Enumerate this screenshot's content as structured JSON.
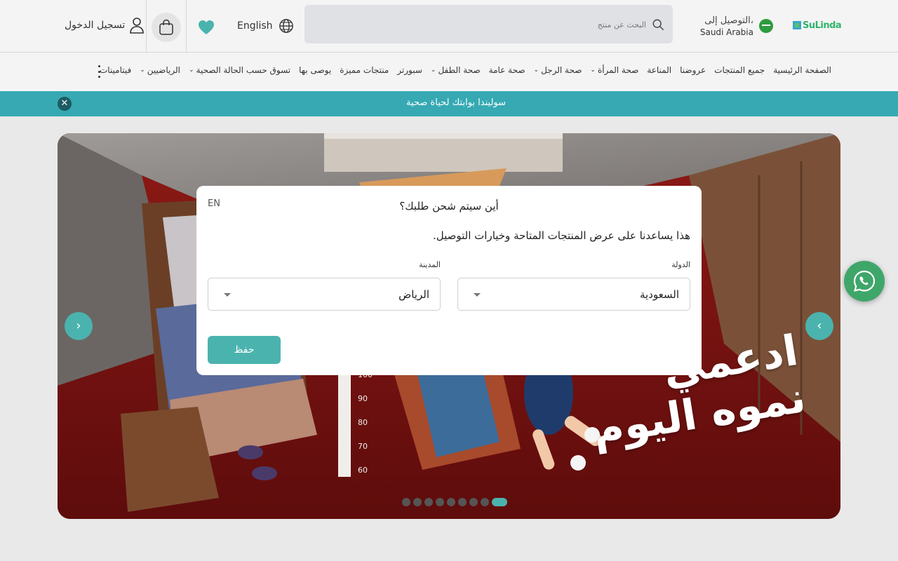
{
  "header": {
    "logo_text": "SuLinda",
    "delivery_label": "التوصيل إلى،",
    "delivery_country": "Saudi Arabia",
    "search_placeholder": "البحث عن منتج",
    "language_label": "English",
    "login_label": "تسجيل الدخول"
  },
  "nav": {
    "items": [
      {
        "label": "الصفحة الرئيسية",
        "dropdown": false
      },
      {
        "label": "جميع المنتجات",
        "dropdown": false
      },
      {
        "label": "عروضنا",
        "dropdown": false
      },
      {
        "label": "المناعة",
        "dropdown": false
      },
      {
        "label": "صحة المرأة",
        "dropdown": true
      },
      {
        "label": "صحة الرجل",
        "dropdown": true
      },
      {
        "label": "صحة عامة",
        "dropdown": false
      },
      {
        "label": "صحة الطفل",
        "dropdown": true
      },
      {
        "label": "سبورتر",
        "dropdown": false
      },
      {
        "label": "منتجات مميزة",
        "dropdown": false
      },
      {
        "label": "يوصى بها",
        "dropdown": false
      },
      {
        "label": "تسوق حسب الحالة الصحية",
        "dropdown": true
      },
      {
        "label": "الرياضيين",
        "dropdown": true
      },
      {
        "label": "فيتامينات",
        "dropdown": false
      }
    ]
  },
  "banner": {
    "text": "سوليندا بوابتك لحياة صحية",
    "close_glyph": "✕"
  },
  "hero": {
    "slogan_line1": "ادعمي",
    "slogan_line2": "نموه اليوم",
    "height_marks": [
      "100",
      "90",
      "80",
      "70",
      "60"
    ],
    "prev_glyph": "‹",
    "next_glyph": "›",
    "slide_count": 9,
    "active_slide": 9
  },
  "modal": {
    "lang_toggle": "EN",
    "title": "أين سيتم شحن طلبك؟",
    "description": "هذا يساعدنا على عرض المنتجات المتاحة وخيارات التوصيل.",
    "country_label": "الدولة",
    "country_value": "السعودية",
    "city_label": "المدينة",
    "city_value": "الرياض",
    "save_label": "حفظ"
  },
  "colors": {
    "accent": "#4bb3ae",
    "banner": "#36a9b3",
    "whatsapp": "#3fa66a"
  },
  "icons": [
    "search-icon",
    "globe-icon",
    "heart-icon",
    "bag-icon",
    "user-icon",
    "kebab-icon",
    "close-icon",
    "whatsapp-icon",
    "chevron-icon"
  ]
}
